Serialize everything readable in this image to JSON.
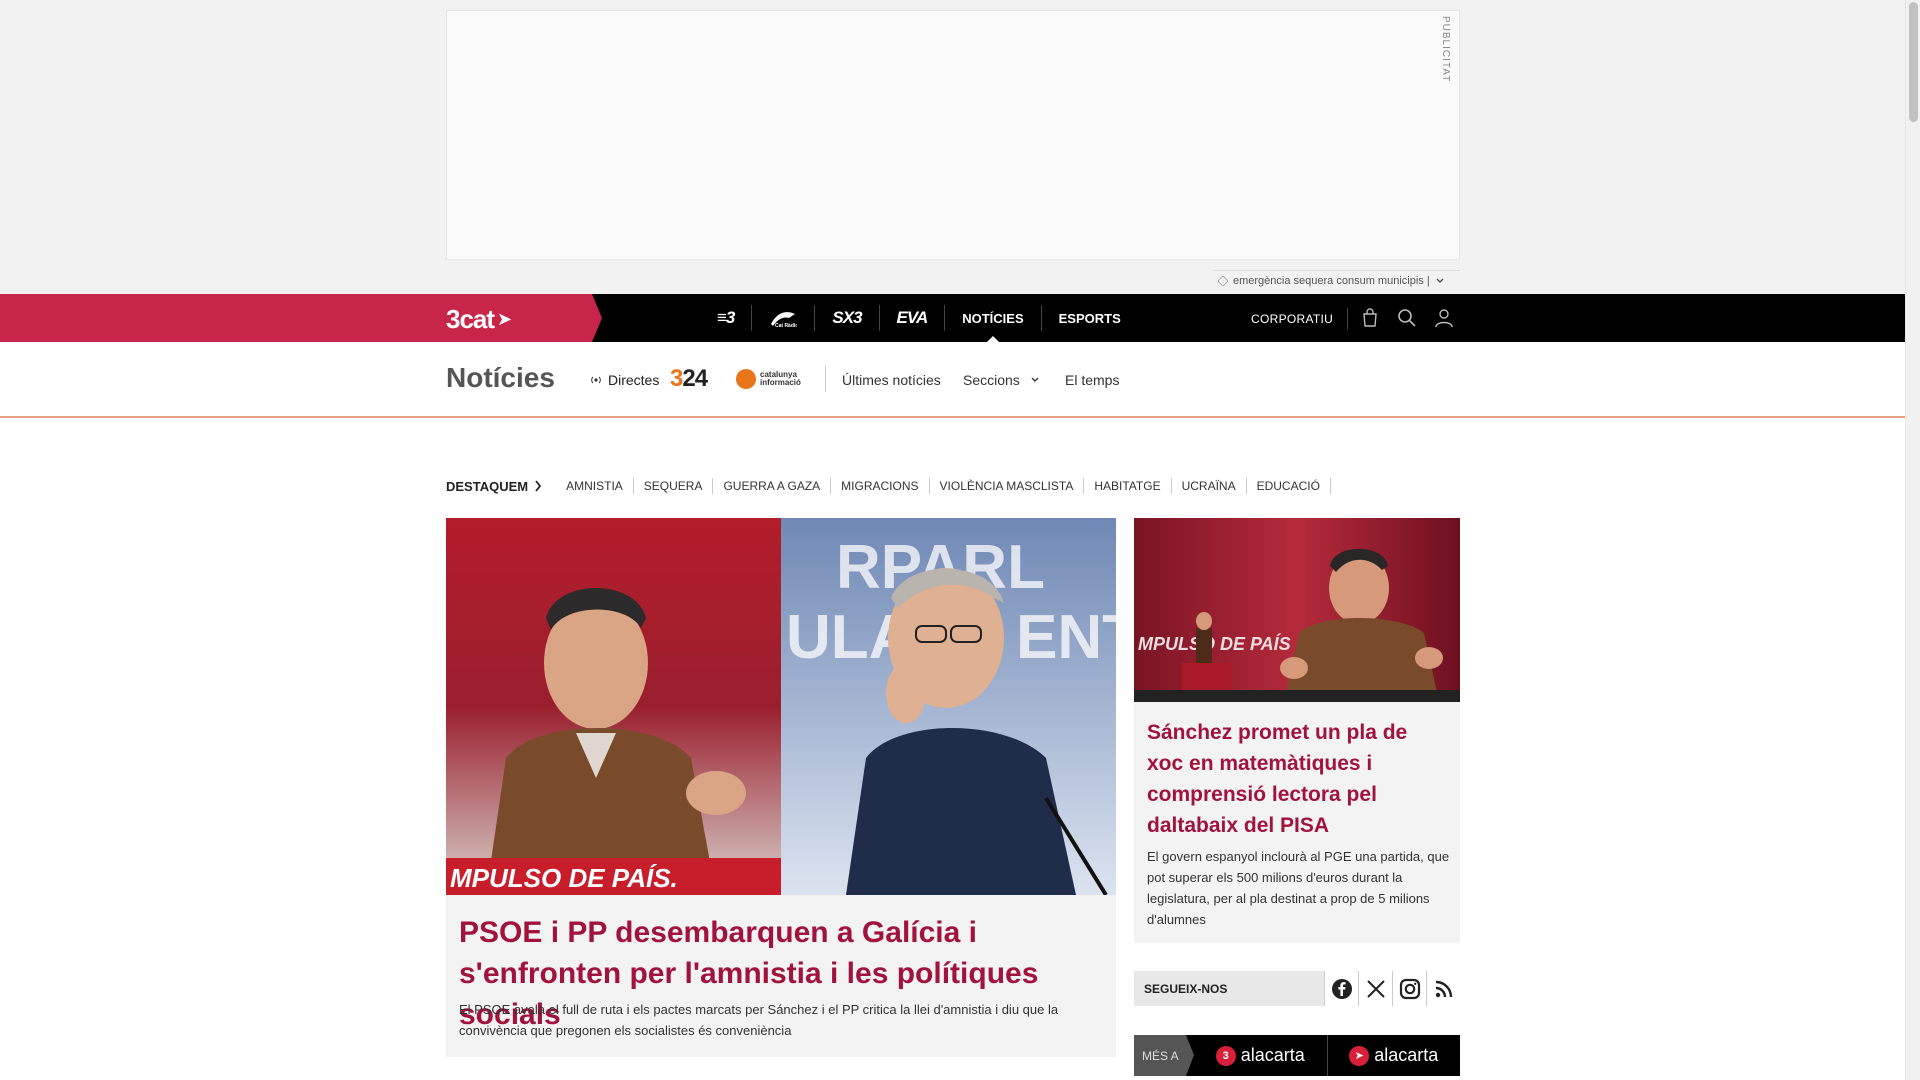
{
  "ad": {
    "label": "PUBLICITAT"
  },
  "trending": {
    "text": "emergència sequera consum municipis |"
  },
  "topnav": {
    "brand": "3cat",
    "channels": [
      {
        "label": "3",
        "icon": "tv3-logo"
      },
      {
        "label": "Cat Ràdio",
        "icon": "catradio-logo"
      },
      {
        "label": "SX3",
        "icon": "sx3-logo"
      },
      {
        "label": "EVA",
        "icon": "eva-logo"
      },
      {
        "label": "NOTÍCIES",
        "icon": ""
      },
      {
        "label": "ESPORTS",
        "icon": ""
      }
    ],
    "corporate": "CORPORATIU"
  },
  "section": {
    "title": "Notícies",
    "live": "Directes",
    "logo_324": "324",
    "logo_catinfo_line1": "catalunya",
    "logo_catinfo_line2": "informació",
    "links": [
      "Últimes notícies",
      "Seccions",
      "El temps"
    ]
  },
  "highlights": {
    "title": "DESTAQUEM",
    "items": [
      "AMNISTIA",
      "SEQUERA",
      "GUERRA A GAZA",
      "MIGRACIONS",
      "VIOLÈNCIA MASCLISTA",
      "HABITATGE",
      "UCRAÏNA",
      "EDUCACIÓ"
    ]
  },
  "main_article": {
    "image_banner": "MPULSO DE PAÍS.",
    "image_bg_text": "RPARL  ENTA\nULAR",
    "title": "PSOE i PP desembarquen a Galícia i s'enfronten per l'amnistia i les polítiques socials",
    "lead": "El PSOE avala el full de ruta i els pactes marcats per Sánchez i el PP critica la llei d'amnistia i diu que la convivència que pregonen els socialistes és conveniència"
  },
  "side_article": {
    "image_text": "MPULSO DE PAÍS",
    "title": "Sánchez promet un pla de xoc en matemàtiques i comprensió lectora pel daltabaix del PISA",
    "lead": "El govern espanyol inclourà al PGE una partida, que pot superar els 500 milions d'euros durant la legislatura, per al pla destinat a prop de 5 milions d'alumnes"
  },
  "follow": {
    "label": "SEGUEIX-NOS",
    "networks": [
      "facebook-icon",
      "x-icon",
      "instagram-icon",
      "rss-icon"
    ]
  },
  "alacarta": {
    "label": "MÉS A",
    "items": [
      {
        "badge": "3",
        "text": "alacarta"
      },
      {
        "badge": "",
        "text": "alacarta"
      }
    ]
  },
  "colors": {
    "brand_pink": "#c8254a",
    "headline": "#a1133d",
    "accent_orange": "#e8751a"
  }
}
